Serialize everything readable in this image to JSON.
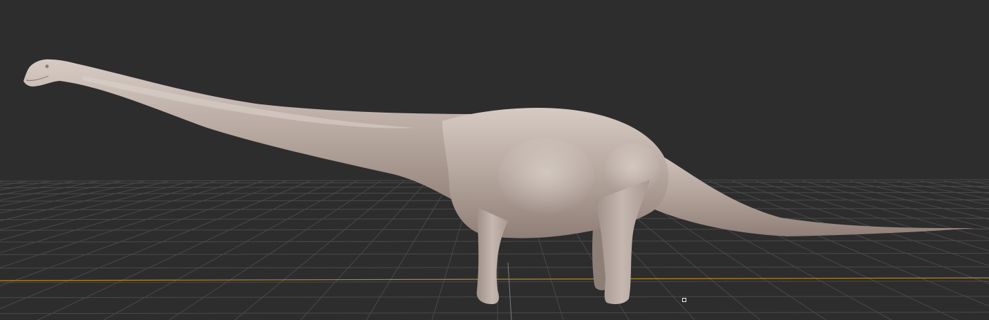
{
  "viewport": {
    "background_color": "#2d2d2d",
    "model_color": "#b8a9a0",
    "model_name_icon": "sauropod-model",
    "grid_color": "#4a4a4a",
    "x_axis_color": "#b78a1f",
    "y_axis_color": "#7d7d7d",
    "grid_visible": true,
    "pivot_icon": "pivot-square-icon"
  }
}
